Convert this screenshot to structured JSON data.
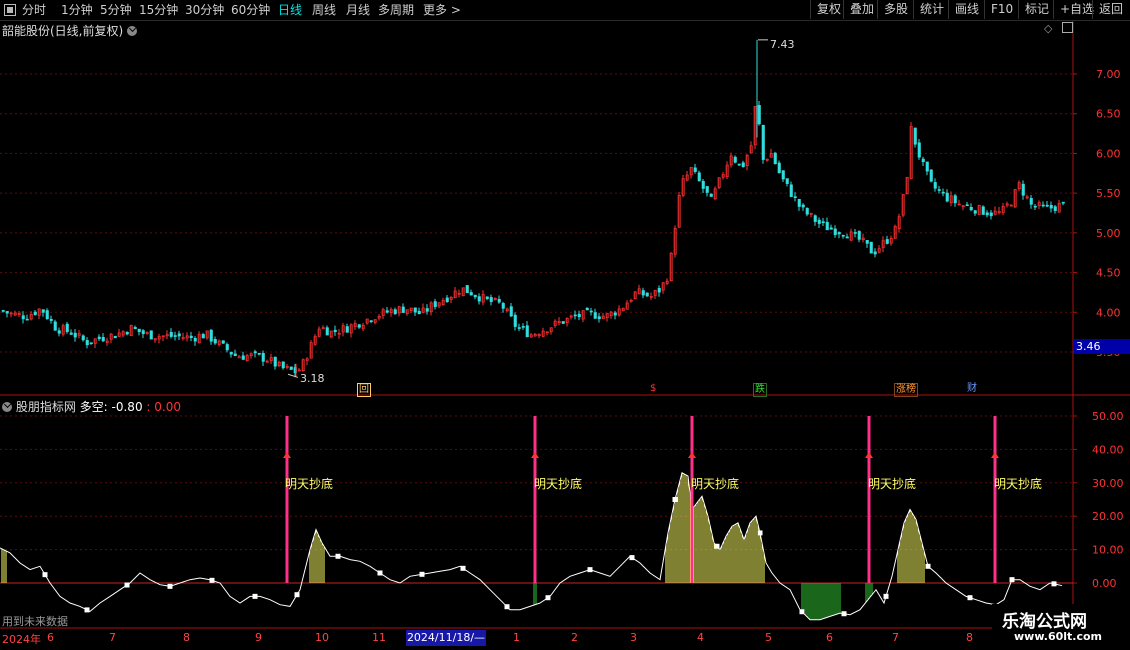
{
  "toolbar": {
    "periods": [
      "分时",
      "1分钟",
      "5分钟",
      "15分钟",
      "30分钟",
      "60分钟",
      "日线",
      "周线",
      "月线",
      "多周期",
      "更多 >"
    ],
    "active_period": "日线",
    "buttons": [
      "复权",
      "叠加",
      "多股",
      "统计",
      "画线",
      "F10",
      "标记",
      "+自选",
      "返回"
    ]
  },
  "main_chart": {
    "stock_title": "韶能股份(日线,前复权)",
    "high_label": "7.43",
    "low_label": "3.18",
    "current_price": "3.46",
    "price_axis": [
      "7.00",
      "6.50",
      "6.00",
      "5.50",
      "5.00",
      "4.50",
      "4.00",
      "3.50"
    ],
    "event_tags": [
      {
        "text": "回",
        "color": "#ffcc66"
      },
      {
        "text": "$",
        "color": "#ff3333"
      },
      {
        "text": "跌",
        "color": "#33dd33"
      },
      {
        "text": "涨榜",
        "color": "#ff9933"
      },
      {
        "text": "财",
        "color": "#6699ff"
      }
    ]
  },
  "indicator": {
    "name": "股朋指标网",
    "line_label": "多空: -0.80",
    "value2": ": 0.00",
    "axis": [
      "50.00",
      "40.00",
      "30.00",
      "20.00",
      "10.00",
      "0.00"
    ],
    "signal_text": "明天抄底",
    "future_note": "用到未来数据"
  },
  "time_axis": {
    "year": "2024年",
    "months": [
      "6",
      "7",
      "8",
      "9",
      "10",
      "11",
      "1",
      "2",
      "3",
      "4",
      "5",
      "6",
      "7",
      "8"
    ],
    "cursor_date": "2024/11/18/—"
  },
  "watermark": {
    "title": "乐淘公式网",
    "url": "www.60lt.com"
  },
  "colors": {
    "up": "#ff3333",
    "down": "#33dddd",
    "signal": "#ff2f8a",
    "bull_bar": "#ffff66",
    "bear_bar": "#33cc33"
  },
  "chart_data": [
    {
      "type": "candlestick",
      "title": "韶能股份(日线,前复权)",
      "y_axis_ticks": [
        3.5,
        4.0,
        4.5,
        5.0,
        5.5,
        6.0,
        6.5,
        7.0
      ],
      "ylim": [
        3.15,
        7.6
      ],
      "annotations": [
        {
          "label": "7.43",
          "value": 7.43
        },
        {
          "label": "3.18",
          "value": 3.18
        }
      ],
      "approx_close_path": [
        [
          0,
          4.02
        ],
        [
          10,
          3.98
        ],
        [
          25,
          3.95
        ],
        [
          40,
          4.05
        ],
        [
          55,
          3.8
        ],
        [
          70,
          3.75
        ],
        [
          85,
          3.62
        ],
        [
          100,
          3.68
        ],
        [
          115,
          3.72
        ],
        [
          130,
          3.8
        ],
        [
          145,
          3.72
        ],
        [
          160,
          3.7
        ],
        [
          175,
          3.7
        ],
        [
          190,
          3.68
        ],
        [
          205,
          3.72
        ],
        [
          220,
          3.58
        ],
        [
          235,
          3.45
        ],
        [
          250,
          3.45
        ],
        [
          265,
          3.42
        ],
        [
          280,
          3.3
        ],
        [
          295,
          3.25
        ],
        [
          300,
          3.3
        ],
        [
          310,
          3.58
        ],
        [
          318,
          3.82
        ],
        [
          330,
          3.75
        ],
        [
          345,
          3.8
        ],
        [
          360,
          3.88
        ],
        [
          375,
          3.96
        ],
        [
          390,
          4.02
        ],
        [
          405,
          4.05
        ],
        [
          420,
          3.98
        ],
        [
          435,
          4.12
        ],
        [
          450,
          4.22
        ],
        [
          460,
          4.3
        ],
        [
          470,
          4.25
        ],
        [
          485,
          4.15
        ],
        [
          500,
          4.1
        ],
        [
          515,
          3.82
        ],
        [
          530,
          3.72
        ],
        [
          545,
          3.8
        ],
        [
          560,
          3.88
        ],
        [
          575,
          3.95
        ],
        [
          590,
          3.98
        ],
        [
          605,
          3.95
        ],
        [
          620,
          4.05
        ],
        [
          635,
          4.25
        ],
        [
          650,
          4.2
        ],
        [
          660,
          4.3
        ],
        [
          668,
          4.5
        ],
        [
          675,
          5.2
        ],
        [
          680,
          5.6
        ],
        [
          690,
          5.8
        ],
        [
          700,
          5.6
        ],
        [
          710,
          5.4
        ],
        [
          720,
          5.7
        ],
        [
          730,
          6.0
        ],
        [
          740,
          5.8
        ],
        [
          750,
          6.1
        ],
        [
          756,
          6.8
        ],
        [
          760,
          5.9
        ],
        [
          770,
          6.0
        ],
        [
          780,
          5.7
        ],
        [
          790,
          5.5
        ],
        [
          800,
          5.3
        ],
        [
          810,
          5.2
        ],
        [
          820,
          5.1
        ],
        [
          830,
          5.05
        ],
        [
          845,
          5.0
        ],
        [
          860,
          4.9
        ],
        [
          872,
          4.75
        ],
        [
          885,
          4.9
        ],
        [
          895,
          5.05
        ],
        [
          905,
          5.6
        ],
        [
          910,
          6.3
        ],
        [
          920,
          5.9
        ],
        [
          930,
          5.6
        ],
        [
          945,
          5.45
        ],
        [
          960,
          5.35
        ],
        [
          975,
          5.3
        ],
        [
          990,
          5.25
        ],
        [
          1000,
          5.25
        ],
        [
          1010,
          5.4
        ],
        [
          1018,
          5.6
        ],
        [
          1030,
          5.35
        ],
        [
          1045,
          5.3
        ],
        [
          1060,
          5.35
        ]
      ]
    },
    {
      "type": "bar",
      "title": "股朋指标网",
      "series_labels": [
        "多空"
      ],
      "y_axis_ticks": [
        0,
        10,
        20,
        30,
        40,
        50
      ],
      "ylim": [
        -12,
        52
      ],
      "signal_positions_x": [
        287,
        535,
        692,
        869,
        995
      ],
      "line": [
        [
          0,
          10.5
        ],
        [
          10,
          9
        ],
        [
          20,
          6
        ],
        [
          30,
          4
        ],
        [
          40,
          5
        ],
        [
          50,
          0
        ],
        [
          60,
          -4
        ],
        [
          70,
          -6
        ],
        [
          80,
          -7
        ],
        [
          90,
          -8.5
        ],
        [
          100,
          -6
        ],
        [
          110,
          -4
        ],
        [
          120,
          -2
        ],
        [
          130,
          0
        ],
        [
          140,
          3
        ],
        [
          150,
          1
        ],
        [
          160,
          -0.5
        ],
        [
          170,
          -1
        ],
        [
          180,
          0
        ],
        [
          190,
          1
        ],
        [
          200,
          1.5
        ],
        [
          210,
          1
        ],
        [
          220,
          0
        ],
        [
          230,
          -4
        ],
        [
          240,
          -6
        ],
        [
          250,
          -4
        ],
        [
          260,
          -4
        ],
        [
          270,
          -5
        ],
        [
          280,
          -6.5
        ],
        [
          290,
          -7
        ],
        [
          300,
          -2
        ],
        [
          310,
          10
        ],
        [
          316,
          16
        ],
        [
          322,
          12
        ],
        [
          330,
          8
        ],
        [
          340,
          8
        ],
        [
          350,
          7
        ],
        [
          360,
          6.5
        ],
        [
          370,
          5
        ],
        [
          380,
          3
        ],
        [
          390,
          1
        ],
        [
          400,
          0
        ],
        [
          410,
          2
        ],
        [
          420,
          2.5
        ],
        [
          430,
          3
        ],
        [
          440,
          3.5
        ],
        [
          450,
          4
        ],
        [
          460,
          5
        ],
        [
          470,
          3
        ],
        [
          480,
          1
        ],
        [
          490,
          -2
        ],
        [
          500,
          -5
        ],
        [
          510,
          -8
        ],
        [
          520,
          -8
        ],
        [
          530,
          -7
        ],
        [
          540,
          -6
        ],
        [
          550,
          -4
        ],
        [
          560,
          0
        ],
        [
          570,
          2
        ],
        [
          580,
          3
        ],
        [
          590,
          4
        ],
        [
          600,
          3
        ],
        [
          610,
          2
        ],
        [
          620,
          5
        ],
        [
          630,
          8
        ],
        [
          640,
          6
        ],
        [
          650,
          3
        ],
        [
          660,
          1
        ],
        [
          668,
          15
        ],
        [
          675,
          25
        ],
        [
          682,
          33
        ],
        [
          688,
          32
        ],
        [
          692,
          22
        ],
        [
          697,
          24
        ],
        [
          702,
          26
        ],
        [
          708,
          20
        ],
        [
          714,
          12
        ],
        [
          720,
          10
        ],
        [
          726,
          14
        ],
        [
          732,
          17
        ],
        [
          738,
          18
        ],
        [
          744,
          13
        ],
        [
          750,
          18
        ],
        [
          756,
          20
        ],
        [
          760,
          15
        ],
        [
          766,
          6
        ],
        [
          772,
          3
        ],
        [
          780,
          0
        ],
        [
          790,
          -2
        ],
        [
          800,
          -8
        ],
        [
          810,
          -11
        ],
        [
          820,
          -11
        ],
        [
          830,
          -10
        ],
        [
          840,
          -9
        ],
        [
          850,
          -9.5
        ],
        [
          860,
          -8
        ],
        [
          868,
          -5
        ],
        [
          876,
          -2
        ],
        [
          884,
          -6
        ],
        [
          892,
          2
        ],
        [
          898,
          10
        ],
        [
          904,
          18
        ],
        [
          910,
          22
        ],
        [
          916,
          19
        ],
        [
          922,
          12
        ],
        [
          928,
          5
        ],
        [
          936,
          3
        ],
        [
          946,
          0
        ],
        [
          956,
          -2
        ],
        [
          966,
          -4
        ],
        [
          976,
          -5
        ],
        [
          986,
          -6
        ],
        [
          996,
          -6.5
        ],
        [
          1004,
          -5
        ],
        [
          1012,
          1
        ],
        [
          1020,
          1
        ],
        [
          1030,
          -1
        ],
        [
          1040,
          -2
        ],
        [
          1050,
          0
        ],
        [
          1058,
          -0.5
        ],
        [
          1062,
          -0.8
        ]
      ]
    }
  ]
}
